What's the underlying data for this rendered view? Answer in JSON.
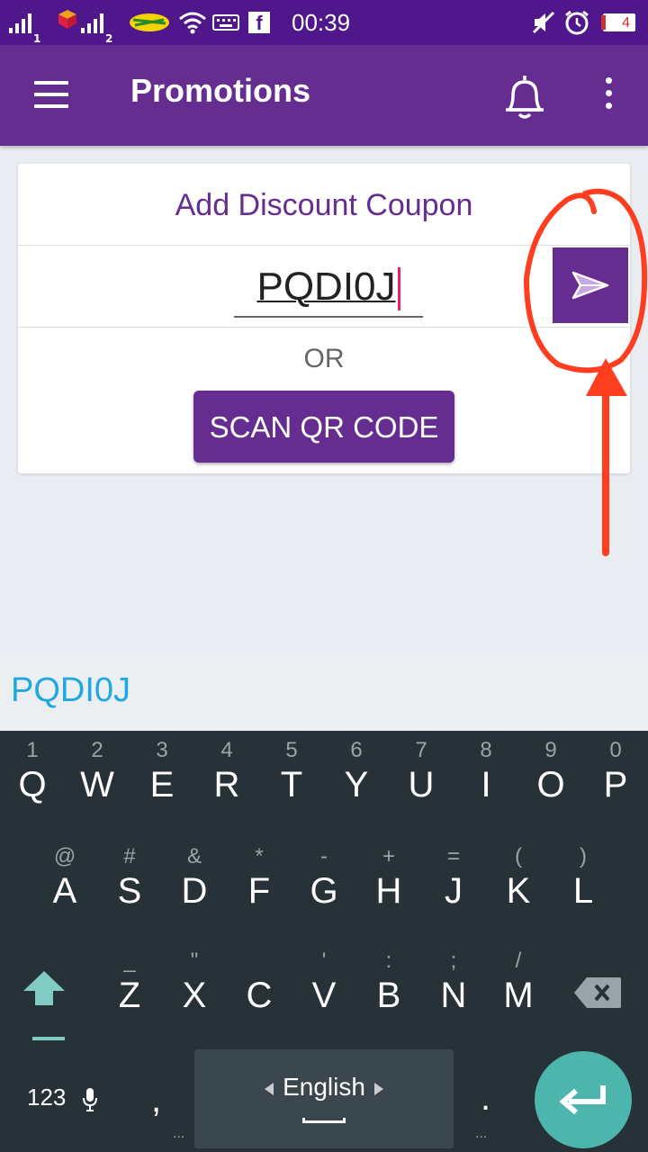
{
  "status_bar": {
    "sim1": "1",
    "sim2": "2",
    "fb_label": "f",
    "time": "00:39",
    "battery": "4"
  },
  "appbar": {
    "title": "Promotions",
    "color": "#662d91"
  },
  "card": {
    "title": "Add Discount Coupon",
    "coupon_value": "PQDI0J",
    "or_label": "OR",
    "scan_label": "SCAN QR CODE"
  },
  "suggestion": {
    "word": "PQDI0J"
  },
  "keyboard": {
    "row1": [
      {
        "hint": "1",
        "key": "Q"
      },
      {
        "hint": "2",
        "key": "W"
      },
      {
        "hint": "3",
        "key": "E"
      },
      {
        "hint": "4",
        "key": "R"
      },
      {
        "hint": "5",
        "key": "T"
      },
      {
        "hint": "6",
        "key": "Y"
      },
      {
        "hint": "7",
        "key": "U"
      },
      {
        "hint": "8",
        "key": "I"
      },
      {
        "hint": "9",
        "key": "O"
      },
      {
        "hint": "0",
        "key": "P"
      }
    ],
    "row2": [
      {
        "hint": "@",
        "key": "A"
      },
      {
        "hint": "#",
        "key": "S"
      },
      {
        "hint": "&",
        "key": "D"
      },
      {
        "hint": "*",
        "key": "F"
      },
      {
        "hint": "-",
        "key": "G"
      },
      {
        "hint": "+",
        "key": "H"
      },
      {
        "hint": "=",
        "key": "J"
      },
      {
        "hint": "(",
        "key": "K"
      },
      {
        "hint": ")",
        "key": "L"
      }
    ],
    "row3": [
      {
        "hint": "_",
        "key": "Z"
      },
      {
        "hint": "\"",
        "key": "X"
      },
      {
        "hint": "",
        "key": "C"
      },
      {
        "hint": "'",
        "key": "V"
      },
      {
        "hint": ":",
        "key": "B"
      },
      {
        "hint": ";",
        "key": "N"
      },
      {
        "hint": "/",
        "key": "M"
      }
    ],
    "symbols_label": "123",
    "comma": ",",
    "space_label": "English",
    "period": ".",
    "dots": "..."
  },
  "colors": {
    "status_bar": "#50178d",
    "accent": "#662d91",
    "enter_key": "#4db6ac",
    "annotation": "#ff3d1f",
    "suggestion_text": "#20a8e0"
  }
}
